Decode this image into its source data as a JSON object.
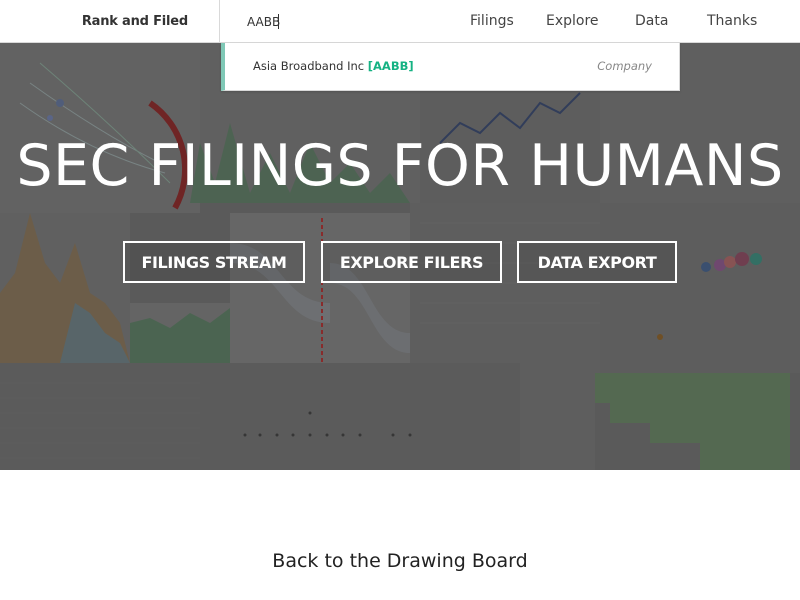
{
  "nav": {
    "brand": "Rank and Filed",
    "search_value": "AABB",
    "links": [
      "Filings",
      "Explore",
      "Data",
      "Thanks"
    ]
  },
  "dropdown": {
    "company_name": "Asia Broadband Inc",
    "ticker": "[AABB]",
    "result_type": "Company",
    "accent_color": "#7fc8b6",
    "ticker_color": "#15b283"
  },
  "hero": {
    "title": "SEC FILINGS FOR HUMANS",
    "buttons": [
      "FILINGS STREAM",
      "EXPLORE FILERS",
      "DATA EXPORT"
    ]
  },
  "footer": {
    "back_link": "Back to the Drawing Board"
  }
}
